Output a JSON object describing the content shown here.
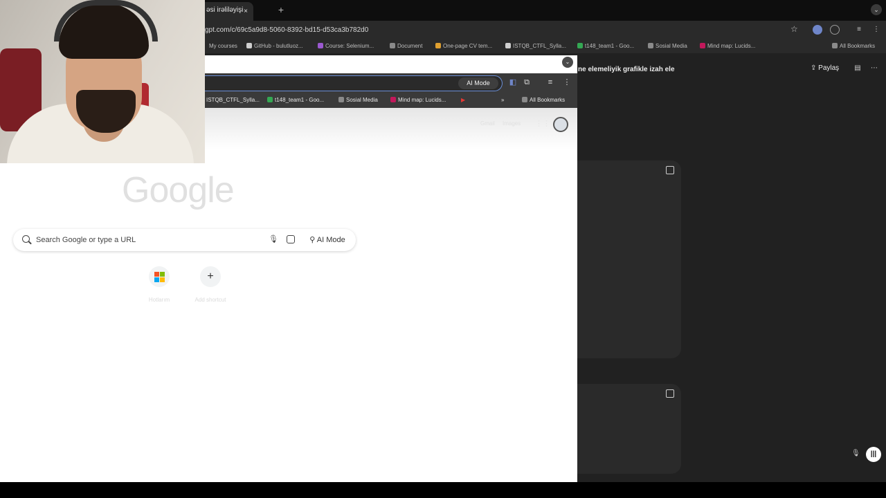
{
  "back_window": {
    "tab_title": "əsi irəliləyişi",
    "tab_close": "×",
    "new_tab": "+",
    "tab_menu": "⌄",
    "url": "gpt.com/c/69c5a9d8-5060-8392-bd15-d53ca3b782d0",
    "bookmarks": [
      {
        "label": "My courses",
        "color": "#6a6a6a"
      },
      {
        "label": "GitHub - bulutluoz...",
        "color": "#cfcfcf"
      },
      {
        "label": "Course: Selenium...",
        "color": "#9b59d0"
      },
      {
        "label": "Document",
        "color": "#8a8a8a"
      },
      {
        "label": "One-page CV tem...",
        "color": "#e0a030"
      },
      {
        "label": "ISTQB_CTFL_Sylla...",
        "color": "#cfcfcf"
      },
      {
        "label": "t148_team1 - Goo...",
        "color": "#34a853"
      },
      {
        "label": "Sosial Media",
        "color": "#8a8a8a"
      },
      {
        "label": "Mind map: Lucids...",
        "color": "#c2185b"
      },
      {
        "label": "All Bookmarks",
        "color": "#8a8a8a"
      }
    ],
    "chat": {
      "header_text": "ne elemeliyik grafikle izah ele",
      "share_label": "Paylaş"
    }
  },
  "front_window": {
    "ai_mode_chip": "AI Mode",
    "bookmarks": [
      {
        "label": "ISTQB_CTFL_Sylla...",
        "color": "#cfcfcf"
      },
      {
        "label": "t148_team1 - Goo...",
        "color": "#34a853"
      },
      {
        "label": "Sosial Media",
        "color": "#8a8a8a"
      },
      {
        "label": "Mind map: Lucids...",
        "color": "#c2185b"
      },
      {
        "label": "All Bookmarks",
        "color": "#8a8a8a"
      }
    ],
    "overflow_chevron": "»",
    "page_links": {
      "gmail": "Gmail",
      "images": "Images"
    },
    "logo": "Google",
    "search": {
      "placeholder": "Search Google or type a URL",
      "ai_mode": "AI Mode"
    },
    "shortcuts": [
      {
        "label": "Hotlarım"
      },
      {
        "label": "Add shortcut"
      }
    ]
  }
}
